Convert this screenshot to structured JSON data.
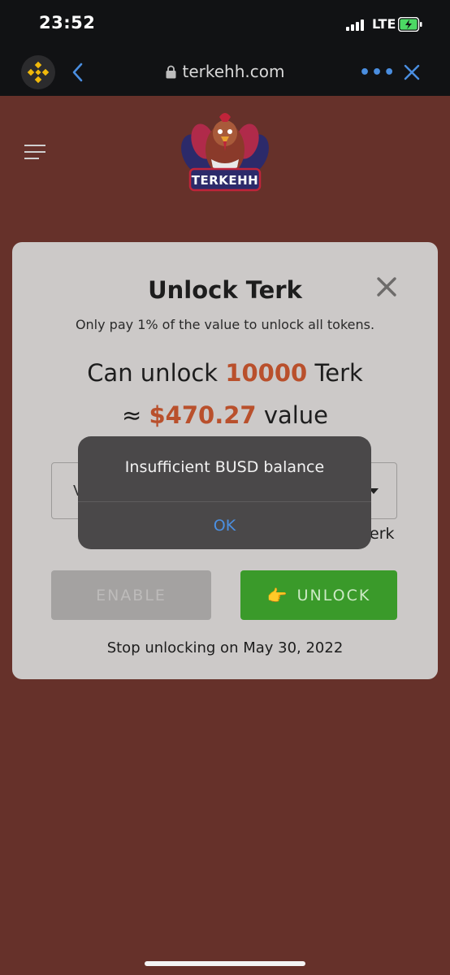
{
  "status_bar": {
    "time": "23:52",
    "network": "LTE"
  },
  "browser": {
    "url": "terkehh.com",
    "more_label": "•••"
  },
  "header": {
    "logo_text": "TERKEHH"
  },
  "modal": {
    "title": "Unlock Terk",
    "subtitle": "Only pay 1% of the value to unlock all tokens.",
    "unlock_prefix": "Can unlock",
    "unlock_amount": "10000",
    "unlock_suffix": "Terk",
    "value_prefix": "≈",
    "value_amount": "$470.27",
    "value_suffix": "value",
    "select_visible_char": "V",
    "balance_suffix": "erk",
    "enable_label": "ENABLE",
    "unlock_button_icon": "👉",
    "unlock_label": "UNLOCK",
    "stop_text": "Stop unlocking on May 30, 2022"
  },
  "alert": {
    "message": "Insufficient BUSD balance",
    "ok_label": "OK"
  },
  "colors": {
    "page_bg": "#66312a",
    "accent": "#b9502c",
    "unlock_green": "#3a9a2a",
    "ios_link": "#4b8fe0"
  }
}
